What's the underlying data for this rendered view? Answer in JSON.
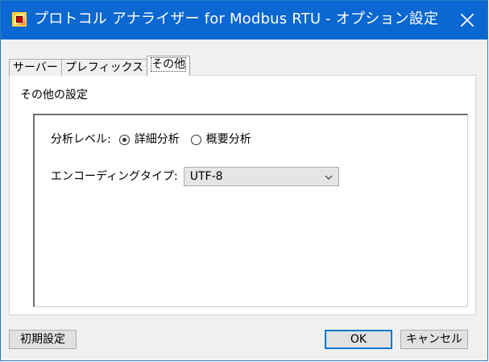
{
  "window": {
    "title": "プロトコル アナライザー for Modbus RTU - オプション設定",
    "close_icon": "close-icon",
    "app_icon": "application-icon"
  },
  "tabs": [
    {
      "label": "サーバー",
      "active": false
    },
    {
      "label": "プレフィックス",
      "active": false
    },
    {
      "label": "その他",
      "active": true
    }
  ],
  "group": {
    "title": "その他の設定"
  },
  "analysis": {
    "label": "分析レベル:",
    "options": [
      {
        "label": "詳細分析",
        "selected": true
      },
      {
        "label": "概要分析",
        "selected": false
      }
    ]
  },
  "encoding": {
    "label": "エンコーディングタイプ:",
    "value": "UTF-8",
    "arrow_icon": "chevron-down-icon"
  },
  "buttons": {
    "initial": "初期設定",
    "ok": "OK",
    "cancel": "キャンセル"
  },
  "colors": {
    "titlebar": "#0b67d1",
    "dialog_background": "#f0f0f0",
    "focus_blue": "#0078d7"
  }
}
